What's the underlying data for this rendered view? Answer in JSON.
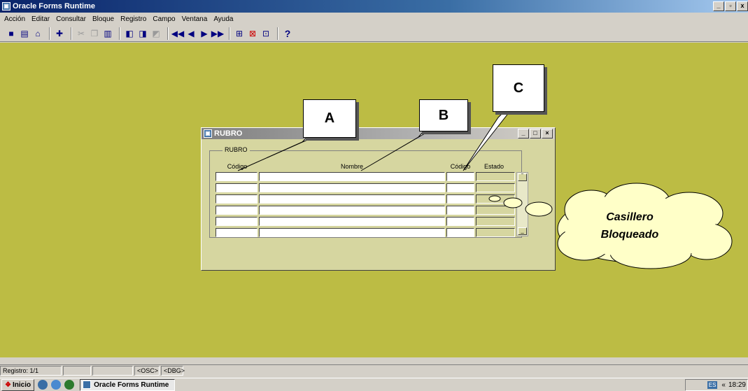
{
  "window": {
    "title": "Oracle Forms Runtime",
    "icon": "oracle-forms-icon",
    "controls": [
      "_",
      "▫",
      "x"
    ]
  },
  "menu": [
    "Acción",
    "Editar",
    "Consultar",
    "Bloque",
    "Registro",
    "Campo",
    "Ventana",
    "Ayuda"
  ],
  "toolbar": {
    "icons": [
      "save-icon",
      "print-icon",
      "exit-icon",
      "insert-record-icon",
      "cut-icon",
      "copy-icon",
      "paste-icon",
      "enter-query-icon",
      "execute-query-icon",
      "cancel-query-icon",
      "previous-block-icon",
      "previous-record-icon",
      "next-record-icon",
      "next-block-icon",
      "insert-row-icon",
      "delete-row-icon",
      "lock-record-icon",
      "help-icon"
    ],
    "help_label": "?"
  },
  "form": {
    "title": "RUBRO",
    "frame_label": "RUBRO",
    "columns": [
      "Código",
      "Nombre",
      "Código",
      "Estado"
    ],
    "rows": 6,
    "window_controls": [
      "_",
      "□",
      "×"
    ]
  },
  "callouts": {
    "a": "A",
    "b": "B",
    "c": "C"
  },
  "cloud": {
    "line1": "Casillero",
    "line2": "Bloqueado"
  },
  "statusbar": {
    "record": "Registro: 1/1",
    "osc": "<OSC>",
    "dbg": "<DBG>"
  },
  "taskbar": {
    "start": "Inicio",
    "task": "Oracle Forms Runtime",
    "lang": "ES",
    "clock": "18:29",
    "arrows": "«"
  }
}
